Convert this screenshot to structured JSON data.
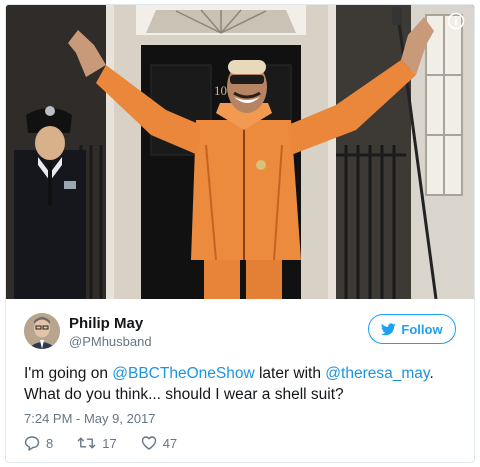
{
  "tweet": {
    "author_name": "Philip May",
    "author_handle": "@PMhusband",
    "follow_label": "Follow",
    "text_part1": "I'm going on ",
    "mention1": "@BBCTheOneShow",
    "text_part2": " later with ",
    "mention2": "@theresa_may",
    "text_part3": ".",
    "text_line2": "What do you think... should I wear a shell suit?",
    "timestamp": "7:24 PM - May 9, 2017",
    "reply_count": "8",
    "retweet_count": "17",
    "like_count": "47"
  },
  "media": {
    "door_number": "10",
    "icons": [
      "info-icon"
    ]
  },
  "colors": {
    "accent": "#1da1f2",
    "link": "#1b95e0",
    "muted": "#657786",
    "border": "#e1e8ed",
    "suit_orange": "#e8843a"
  }
}
